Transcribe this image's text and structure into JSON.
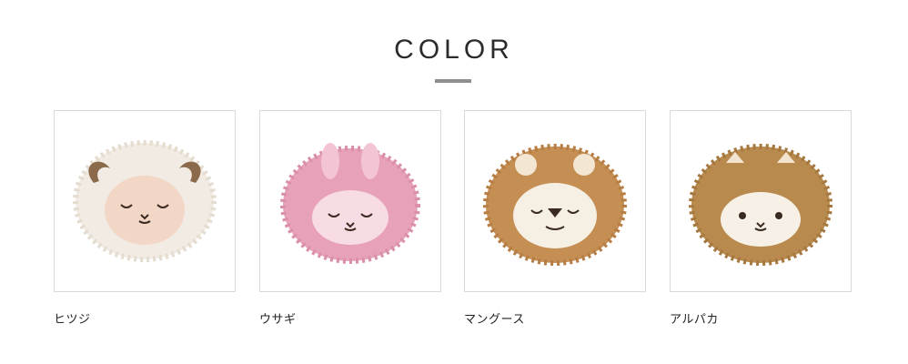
{
  "section": {
    "title": "COLOR"
  },
  "colors": [
    {
      "name": "ヒツジ",
      "image": "sheep-cushion",
      "fur": "#f1ebe3",
      "face": "#f3d7c6",
      "accent": "#8a6a4b"
    },
    {
      "name": "ウサギ",
      "image": "rabbit-cushion",
      "fur": "#e7a1b8",
      "face": "#f7dce3",
      "accent": "#f3c5d4"
    },
    {
      "name": "マングース",
      "image": "mongoose-cushion",
      "fur": "#c58e52",
      "face": "#f6efe4",
      "accent": "#f3e6d2"
    },
    {
      "name": "アルパカ",
      "image": "alpaca-cushion",
      "fur": "#b98a4e",
      "face": "#f6f0e6",
      "accent": "#f1e3cf"
    }
  ]
}
